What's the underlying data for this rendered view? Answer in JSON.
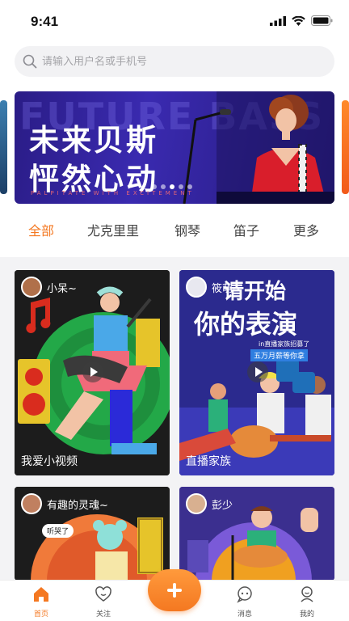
{
  "status_bar": {
    "time": "9:41"
  },
  "search": {
    "placeholder": "请输入用户名或手机号"
  },
  "banner": {
    "line1": "未来贝斯",
    "line2": "怦然心动",
    "bg_text": "FUTURE BASS",
    "small_text": "PALPITATE WITH EXCITEMENT",
    "page_count": 5,
    "active_page": 2
  },
  "tabs": [
    "全部",
    "尤克里里",
    "钢琴",
    "笛子",
    "更多"
  ],
  "active_tab": 0,
  "cards": [
    {
      "user": "小呆~",
      "caption": "我爱小视频",
      "has_play": true
    },
    {
      "user": "筱萌~",
      "caption": "直播家族",
      "has_play": true,
      "poster_title_1": "请开始",
      "poster_title_2": "你的表演",
      "poster_sub": "in直播家族招募了",
      "poster_tag": "五万月薪等你拿"
    },
    {
      "user": "有趣的灵魂~",
      "caption": "",
      "bubble": "听哭了"
    },
    {
      "user": "彭少",
      "caption": ""
    }
  ],
  "nav": [
    {
      "label": "首页",
      "icon": "home-icon",
      "active": true
    },
    {
      "label": "关注",
      "icon": "heart-icon",
      "active": false
    },
    {
      "label": "消息",
      "icon": "message-icon",
      "active": false
    },
    {
      "label": "我的",
      "icon": "profile-icon",
      "active": false
    }
  ],
  "colors": {
    "accent": "#f47821",
    "banner": "#2a1c86",
    "card2_bg": "#2b2a8e",
    "card4_bg": "#3b2f8f"
  }
}
